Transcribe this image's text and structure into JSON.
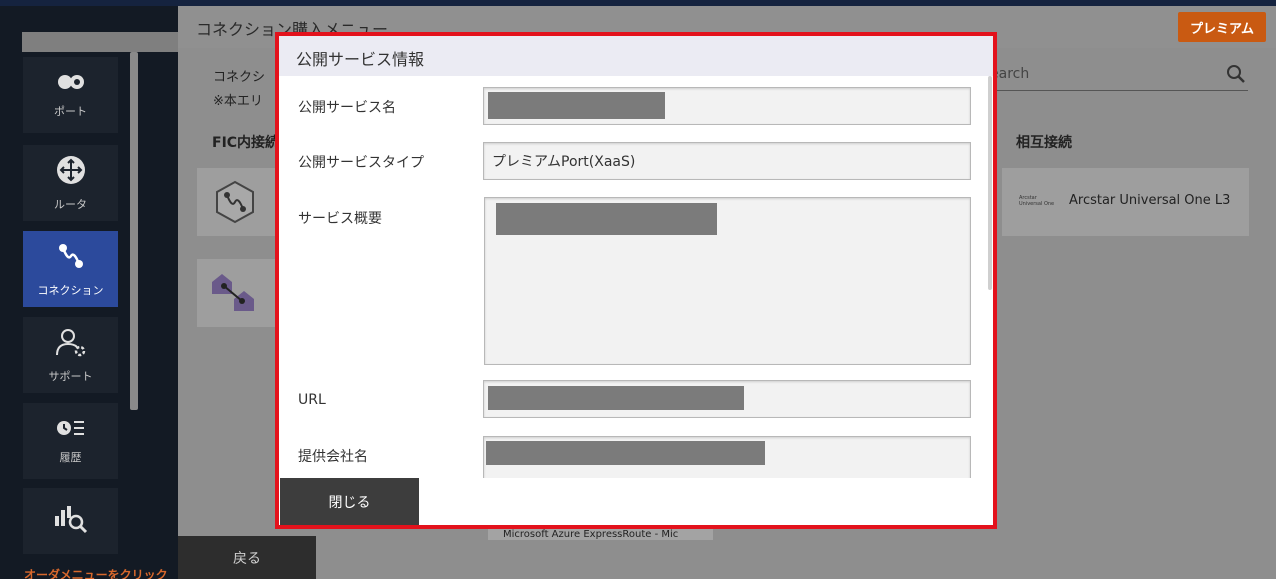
{
  "sidebar": {
    "items": [
      {
        "label": "ポート",
        "icon": "port-icon"
      },
      {
        "label": "ルータ",
        "icon": "router-icon"
      },
      {
        "label": "コネクション",
        "icon": "connection-icon"
      },
      {
        "label": "サポート",
        "icon": "support-icon"
      },
      {
        "label": "履歴",
        "icon": "history-icon"
      },
      {
        "label": "",
        "icon": "monitoring-icon"
      }
    ],
    "order_link": "オーダメニューをクリック"
  },
  "header": {
    "title": "コネクション購入メニュー",
    "premium_label": "プレミアム"
  },
  "background": {
    "desc_line1": "コネクシ",
    "desc_line2": "※本エリ",
    "section_fic": "FIC内接続",
    "section_mutual": "相互接続",
    "search_placeholder": "earch",
    "arcstar_logo_line1": "Arcstar",
    "arcstar_logo_line2": "Universal One",
    "arcstar_label": "Arcstar Universal One L3",
    "azure_label": "Microsoft Azure ExpressRoute - Mic",
    "back_label": "戻る"
  },
  "dialog": {
    "title": "公開サービス情報",
    "fields": [
      {
        "label": "公開サービス名",
        "value": ""
      },
      {
        "label": "公開サービスタイプ",
        "value": "プレミアムPort(XaaS)"
      },
      {
        "label": "サービス概要",
        "value": ""
      },
      {
        "label": "URL",
        "value": ""
      },
      {
        "label": "提供会社名",
        "value": ""
      }
    ],
    "close_label": "閉じる"
  },
  "colors": {
    "accent_red": "#e3121c",
    "premium_orange": "#c95a12",
    "active_nav_blue": "#2c4a9c"
  }
}
